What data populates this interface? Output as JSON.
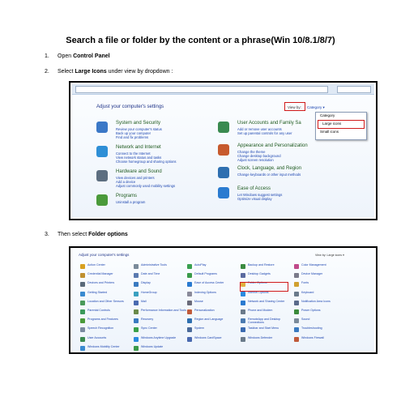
{
  "doc": {
    "title": "Search a file or folder by the content or a phrase(Win 10/8.1/8/7)",
    "step1": {
      "num": "1.",
      "pre": "Open ",
      "bold": "Control Panel",
      "post": ""
    },
    "step2": {
      "num": "2.",
      "pre": "Select ",
      "bold": "Large Icons",
      "post": " under view by dropdown :"
    },
    "step3": {
      "num": "3.",
      "pre": "Then select ",
      "bold": "Folder options",
      "post": ""
    }
  },
  "shot1": {
    "heading": "Adjust your computer's settings",
    "view_by": "View by:",
    "view_value": "Category ▾",
    "dropdown": [
      "Category",
      "Large icons",
      "Small icons"
    ],
    "categories": [
      {
        "title": "System and Security",
        "links": [
          "Review your computer's status",
          "Back up your computer",
          "Find and fix problems"
        ],
        "color": "#3b78c7"
      },
      {
        "title": "Network and Internet",
        "links": [
          "Connect to the Internet",
          "View network status and tasks",
          "Choose homegroup and sharing options"
        ],
        "color": "#2e8fd6"
      },
      {
        "title": "Hardware and Sound",
        "links": [
          "View devices and printers",
          "Add a device",
          "Adjust commonly used mobility settings"
        ],
        "color": "#5d6e80"
      },
      {
        "title": "Programs",
        "links": [
          "Uninstall a program"
        ],
        "color": "#4a9a3a"
      },
      {
        "title": "User Accounts and Family Sa",
        "links": [
          "Add or remove user accounts",
          "Set up parental controls for any user"
        ],
        "color": "#3a8a50"
      },
      {
        "title": "Appearance and Personalization",
        "links": [
          "Change the theme",
          "Change desktop background",
          "Adjust screen resolution"
        ],
        "color": "#c75a2e"
      },
      {
        "title": "Clock, Language, and Region",
        "links": [
          "Change keyboards or other input methods"
        ],
        "color": "#2e6fb0"
      },
      {
        "title": "Ease of Access",
        "links": [
          "Let Windows suggest settings",
          "Optimize visual display"
        ],
        "color": "#2a7bd0"
      }
    ]
  },
  "shot2": {
    "heading": "Adjust your computer's settings",
    "view_by": "View by:   Large icons ▾",
    "items": [
      {
        "label": "Action Center",
        "color": "#d8a020"
      },
      {
        "label": "Administrative Tools",
        "color": "#7a8a9a"
      },
      {
        "label": "AutoPlay",
        "color": "#3aa050"
      },
      {
        "label": "Backup and Restore",
        "color": "#3a8a40"
      },
      {
        "label": "Color Management",
        "color": "#c04a8a"
      },
      {
        "label": "Credential Manager",
        "color": "#c09030"
      },
      {
        "label": "Date and Time",
        "color": "#5a7ab0"
      },
      {
        "label": "Default Programs",
        "color": "#3a9a4a"
      },
      {
        "label": "Desktop Gadgets",
        "color": "#5a6aa0"
      },
      {
        "label": "Device Manager",
        "color": "#7a7a8a"
      },
      {
        "label": "Devices and Printers",
        "color": "#5a6a7a"
      },
      {
        "label": "Display",
        "color": "#3a7ac0"
      },
      {
        "label": "Ease of Access Center",
        "color": "#2a7ad0"
      },
      {
        "label": "Folder Options",
        "color": "#e0b040"
      },
      {
        "label": "Fonts",
        "color": "#d0a030"
      },
      {
        "label": "Getting Started",
        "color": "#3a8ad0"
      },
      {
        "label": "HomeGroup",
        "color": "#3aa0c0"
      },
      {
        "label": "Indexing Options",
        "color": "#8a8a9a"
      },
      {
        "label": "Internet Options",
        "color": "#2a8ae0"
      },
      {
        "label": "Keyboard",
        "color": "#6a7a8a"
      },
      {
        "label": "Location and Other Sensors",
        "color": "#4a9a5a"
      },
      {
        "label": "Mail",
        "color": "#4a6ab0"
      },
      {
        "label": "Mouse",
        "color": "#6a6a7a"
      },
      {
        "label": "Network and Sharing Center",
        "color": "#2a7ad0"
      },
      {
        "label": "Notification Area Icons",
        "color": "#5a6a8a"
      },
      {
        "label": "Parental Controls",
        "color": "#3a9a5a"
      },
      {
        "label": "Performance Information and Tools",
        "color": "#6a8a4a"
      },
      {
        "label": "Personalization",
        "color": "#c05a3a"
      },
      {
        "label": "Phone and Modem",
        "color": "#6a7a8a"
      },
      {
        "label": "Power Options",
        "color": "#3a8a3a"
      },
      {
        "label": "Programs and Features",
        "color": "#4a9a3a"
      },
      {
        "label": "Recovery",
        "color": "#3a7ac0"
      },
      {
        "label": "Region and Language",
        "color": "#2e6fb0"
      },
      {
        "label": "RemoteApp and Desktop Connections",
        "color": "#4a7ab0"
      },
      {
        "label": "Sound",
        "color": "#7a8a9a"
      },
      {
        "label": "Speech Recognition",
        "color": "#7a8aa0"
      },
      {
        "label": "Sync Center",
        "color": "#3aa04a"
      },
      {
        "label": "System",
        "color": "#4a6a9a"
      },
      {
        "label": "Taskbar and Start Menu",
        "color": "#3a6ab0"
      },
      {
        "label": "Troubleshooting",
        "color": "#3a7ac0"
      },
      {
        "label": "User Accounts",
        "color": "#3a8a50"
      },
      {
        "label": "Windows Anytime Upgrade",
        "color": "#2a8ae0"
      },
      {
        "label": "Windows CardSpace",
        "color": "#4a6ab0"
      },
      {
        "label": "Windows Defender",
        "color": "#6a7a8a"
      },
      {
        "label": "Windows Firewall",
        "color": "#c05a3a"
      },
      {
        "label": "Windows Mobility Center",
        "color": "#3a8ad0"
      },
      {
        "label": "Windows Update",
        "color": "#3a9a4a"
      }
    ]
  }
}
